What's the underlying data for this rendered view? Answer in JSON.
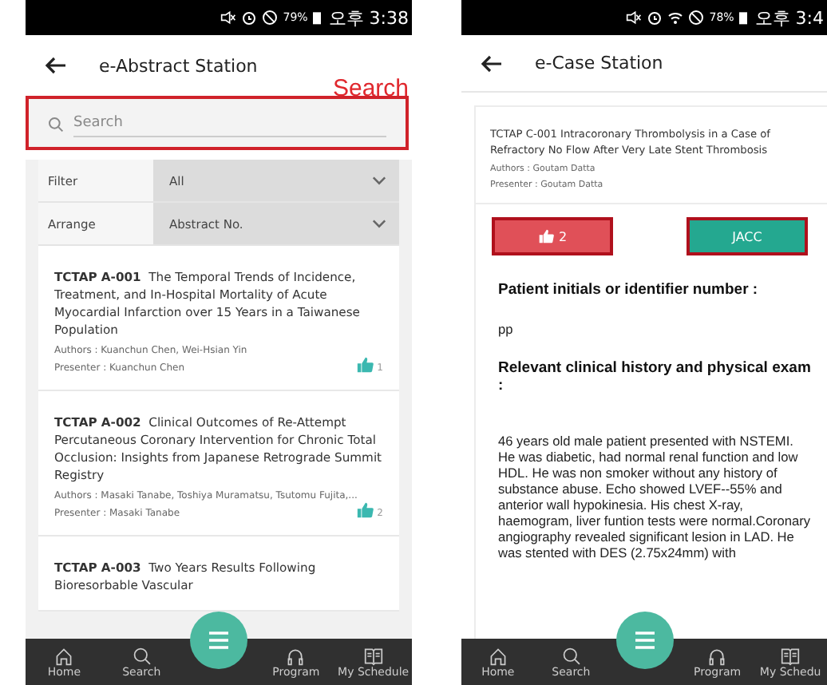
{
  "left": {
    "status": {
      "battery": "79%",
      "time": "오후 3:38"
    },
    "title": "e-Abstract Station",
    "search_label": "Search",
    "search": {
      "placeholder": "Search",
      "highlighted": true
    },
    "filters": [
      {
        "label": "Filter",
        "value": "All"
      },
      {
        "label": "Arrange",
        "value": "Abstract No."
      }
    ],
    "abstracts": [
      {
        "code": "TCTAP A-001",
        "title": "The Temporal Trends of Incidence, Treatment, and In-Hospital Mortality of Acute Myocardial Infarction over 15 Years in a Taiwanese Population",
        "authors": "Authors : Kuanchun Chen, Wei-Hsian Yin",
        "presenter": "Presenter : Kuanchun Chen",
        "likes": "1"
      },
      {
        "code": "TCTAP A-002",
        "title": "Clinical Outcomes of Re-Attempt Percutaneous Coronary Intervention for Chronic Total Occlusion: Insights from Japanese Retrograde Summit Registry",
        "authors": "Authors : Masaki Tanabe, Toshiya Muramatsu, Tsutomu Fujita,...",
        "presenter": "Presenter : Masaki Tanabe",
        "likes": "2"
      },
      {
        "code": "TCTAP A-003",
        "title": "Two Years Results Following Bioresorbable Vascular"
      }
    ],
    "nav": [
      {
        "kind": "home",
        "label": "Home"
      },
      {
        "kind": "search",
        "label": "Search"
      },
      {
        "kind": "program",
        "label": "Program"
      },
      {
        "kind": "schedule",
        "label": "My Schedule"
      }
    ]
  },
  "right": {
    "status": {
      "battery": "78%",
      "time": "오후 3:4"
    },
    "title": "e-Case Station",
    "case": {
      "title": "TCTAP C-001 Intracoronary Thrombolysis in a Case of Refractory No Flow After Very Late Stent Thrombosis",
      "authors": "Authors : Goutam Datta",
      "presenter": "Presenter : Goutam Datta"
    },
    "actions": [
      {
        "kind": "like",
        "label": "2",
        "highlighted": true
      },
      {
        "kind": "link",
        "label": "JACC",
        "highlighted": true
      }
    ],
    "sections": [
      {
        "heading": "Patient initials or identifier number :",
        "body": "pp"
      },
      {
        "heading": "Relevant clinical history and physical exam :",
        "body": "46 years old male patient  presented with NSTEMI. He was diabetic, had normal renal function and low HDL. He was non smoker without any history of substance abuse. Echo showed LVEF--55% and anterior wall hypokinesia. His chest X-ray, haemogram, liver funtion tests were normal.Coronary angiography revealed significant lesion in LAD. He was stented with DES (2.75x24mm) with"
      }
    ],
    "nav": [
      {
        "kind": "home",
        "label": "Home"
      },
      {
        "kind": "search",
        "label": "Search"
      },
      {
        "kind": "program",
        "label": "Program"
      },
      {
        "kind": "schedule",
        "label": "My Schedu"
      }
    ]
  }
}
